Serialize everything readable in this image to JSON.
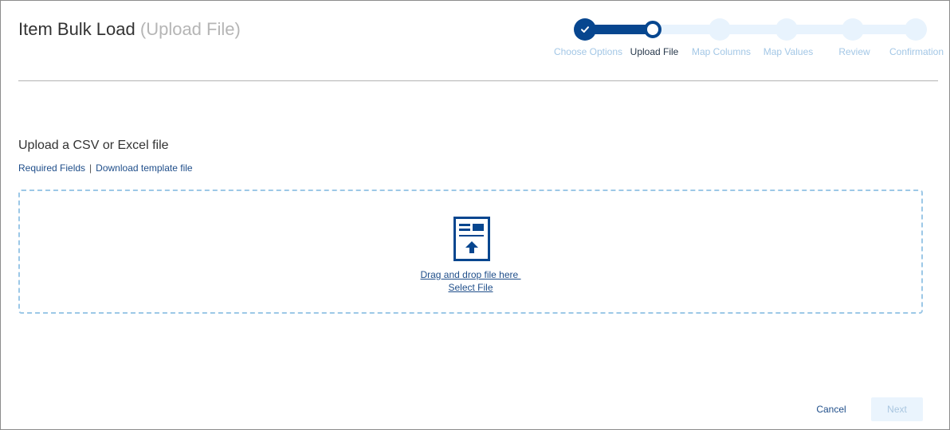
{
  "header": {
    "title": "Item Bulk Load",
    "subtitle": "(Upload File)"
  },
  "stepper": {
    "current_step": 2,
    "steps": [
      {
        "label": "Choose Options",
        "state": "completed"
      },
      {
        "label": "Upload File",
        "state": "active"
      },
      {
        "label": "Map Columns",
        "state": "pending"
      },
      {
        "label": "Map Values",
        "state": "pending"
      },
      {
        "label": "Review",
        "state": "pending"
      },
      {
        "label": "Confirmation",
        "state": "pending"
      }
    ]
  },
  "upload": {
    "heading": "Upload a CSV or Excel file",
    "required_fields_link": "Required Fields",
    "separator": "|",
    "template_link": "Download template file",
    "dropzone": {
      "drag_text": "Drag and drop file here ",
      "select_text": "Select File",
      "icon": "file-upload-icon"
    }
  },
  "footer": {
    "cancel_label": "Cancel",
    "next_label": "Next",
    "next_enabled": false
  },
  "colors": {
    "brand_blue": "#07468f",
    "pending_step": "#e8f3fd",
    "link": "#1f4e8a",
    "dropzone_border": "#9cc8e7"
  }
}
